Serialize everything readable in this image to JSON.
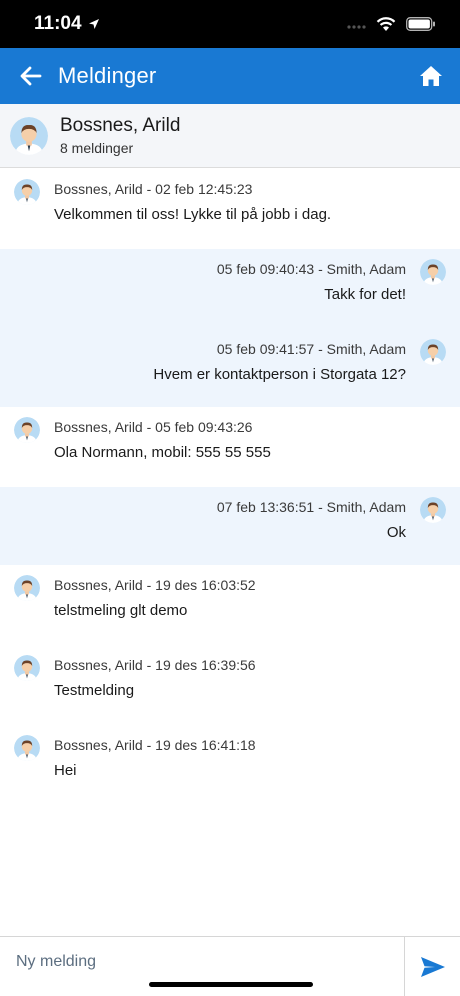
{
  "status_bar": {
    "time": "11:04"
  },
  "nav": {
    "title": "Meldinger"
  },
  "contact": {
    "name": "Bossnes, Arild",
    "message_count": "8 meldinger"
  },
  "messages": [
    {
      "direction": "incoming",
      "meta": "Bossnes, Arild - 02 feb 12:45:23",
      "text": "Velkommen til oss! Lykke til på jobb i dag."
    },
    {
      "direction": "outgoing",
      "meta": "05 feb 09:40:43 - Smith, Adam",
      "text": "Takk for det!"
    },
    {
      "direction": "outgoing",
      "meta": "05 feb 09:41:57 - Smith, Adam",
      "text": "Hvem er kontaktperson i Storgata 12?"
    },
    {
      "direction": "incoming",
      "meta": "Bossnes, Arild - 05 feb 09:43:26",
      "text": "Ola Normann, mobil: 555 55 555"
    },
    {
      "direction": "outgoing",
      "meta": "07 feb 13:36:51 - Smith, Adam",
      "text": "Ok"
    },
    {
      "direction": "incoming",
      "meta": "Bossnes, Arild - 19 des 16:03:52",
      "text": "telstmeling glt demo"
    },
    {
      "direction": "incoming",
      "meta": "Bossnes, Arild - 19 des 16:39:56",
      "text": "Testmelding"
    },
    {
      "direction": "incoming",
      "meta": "Bossnes, Arild - 19 des 16:41:18",
      "text": "Hei"
    }
  ],
  "composer": {
    "placeholder": "Ny melding",
    "value": ""
  },
  "colors": {
    "accent": "#1979d3",
    "outgoing_bg": "#eef5fd",
    "header_bg": "#f4f6f9"
  },
  "icons": [
    "location-arrow-icon",
    "signal-icon",
    "wifi-icon",
    "battery-icon",
    "back-arrow-icon",
    "home-icon",
    "avatar-icon",
    "send-icon"
  ]
}
